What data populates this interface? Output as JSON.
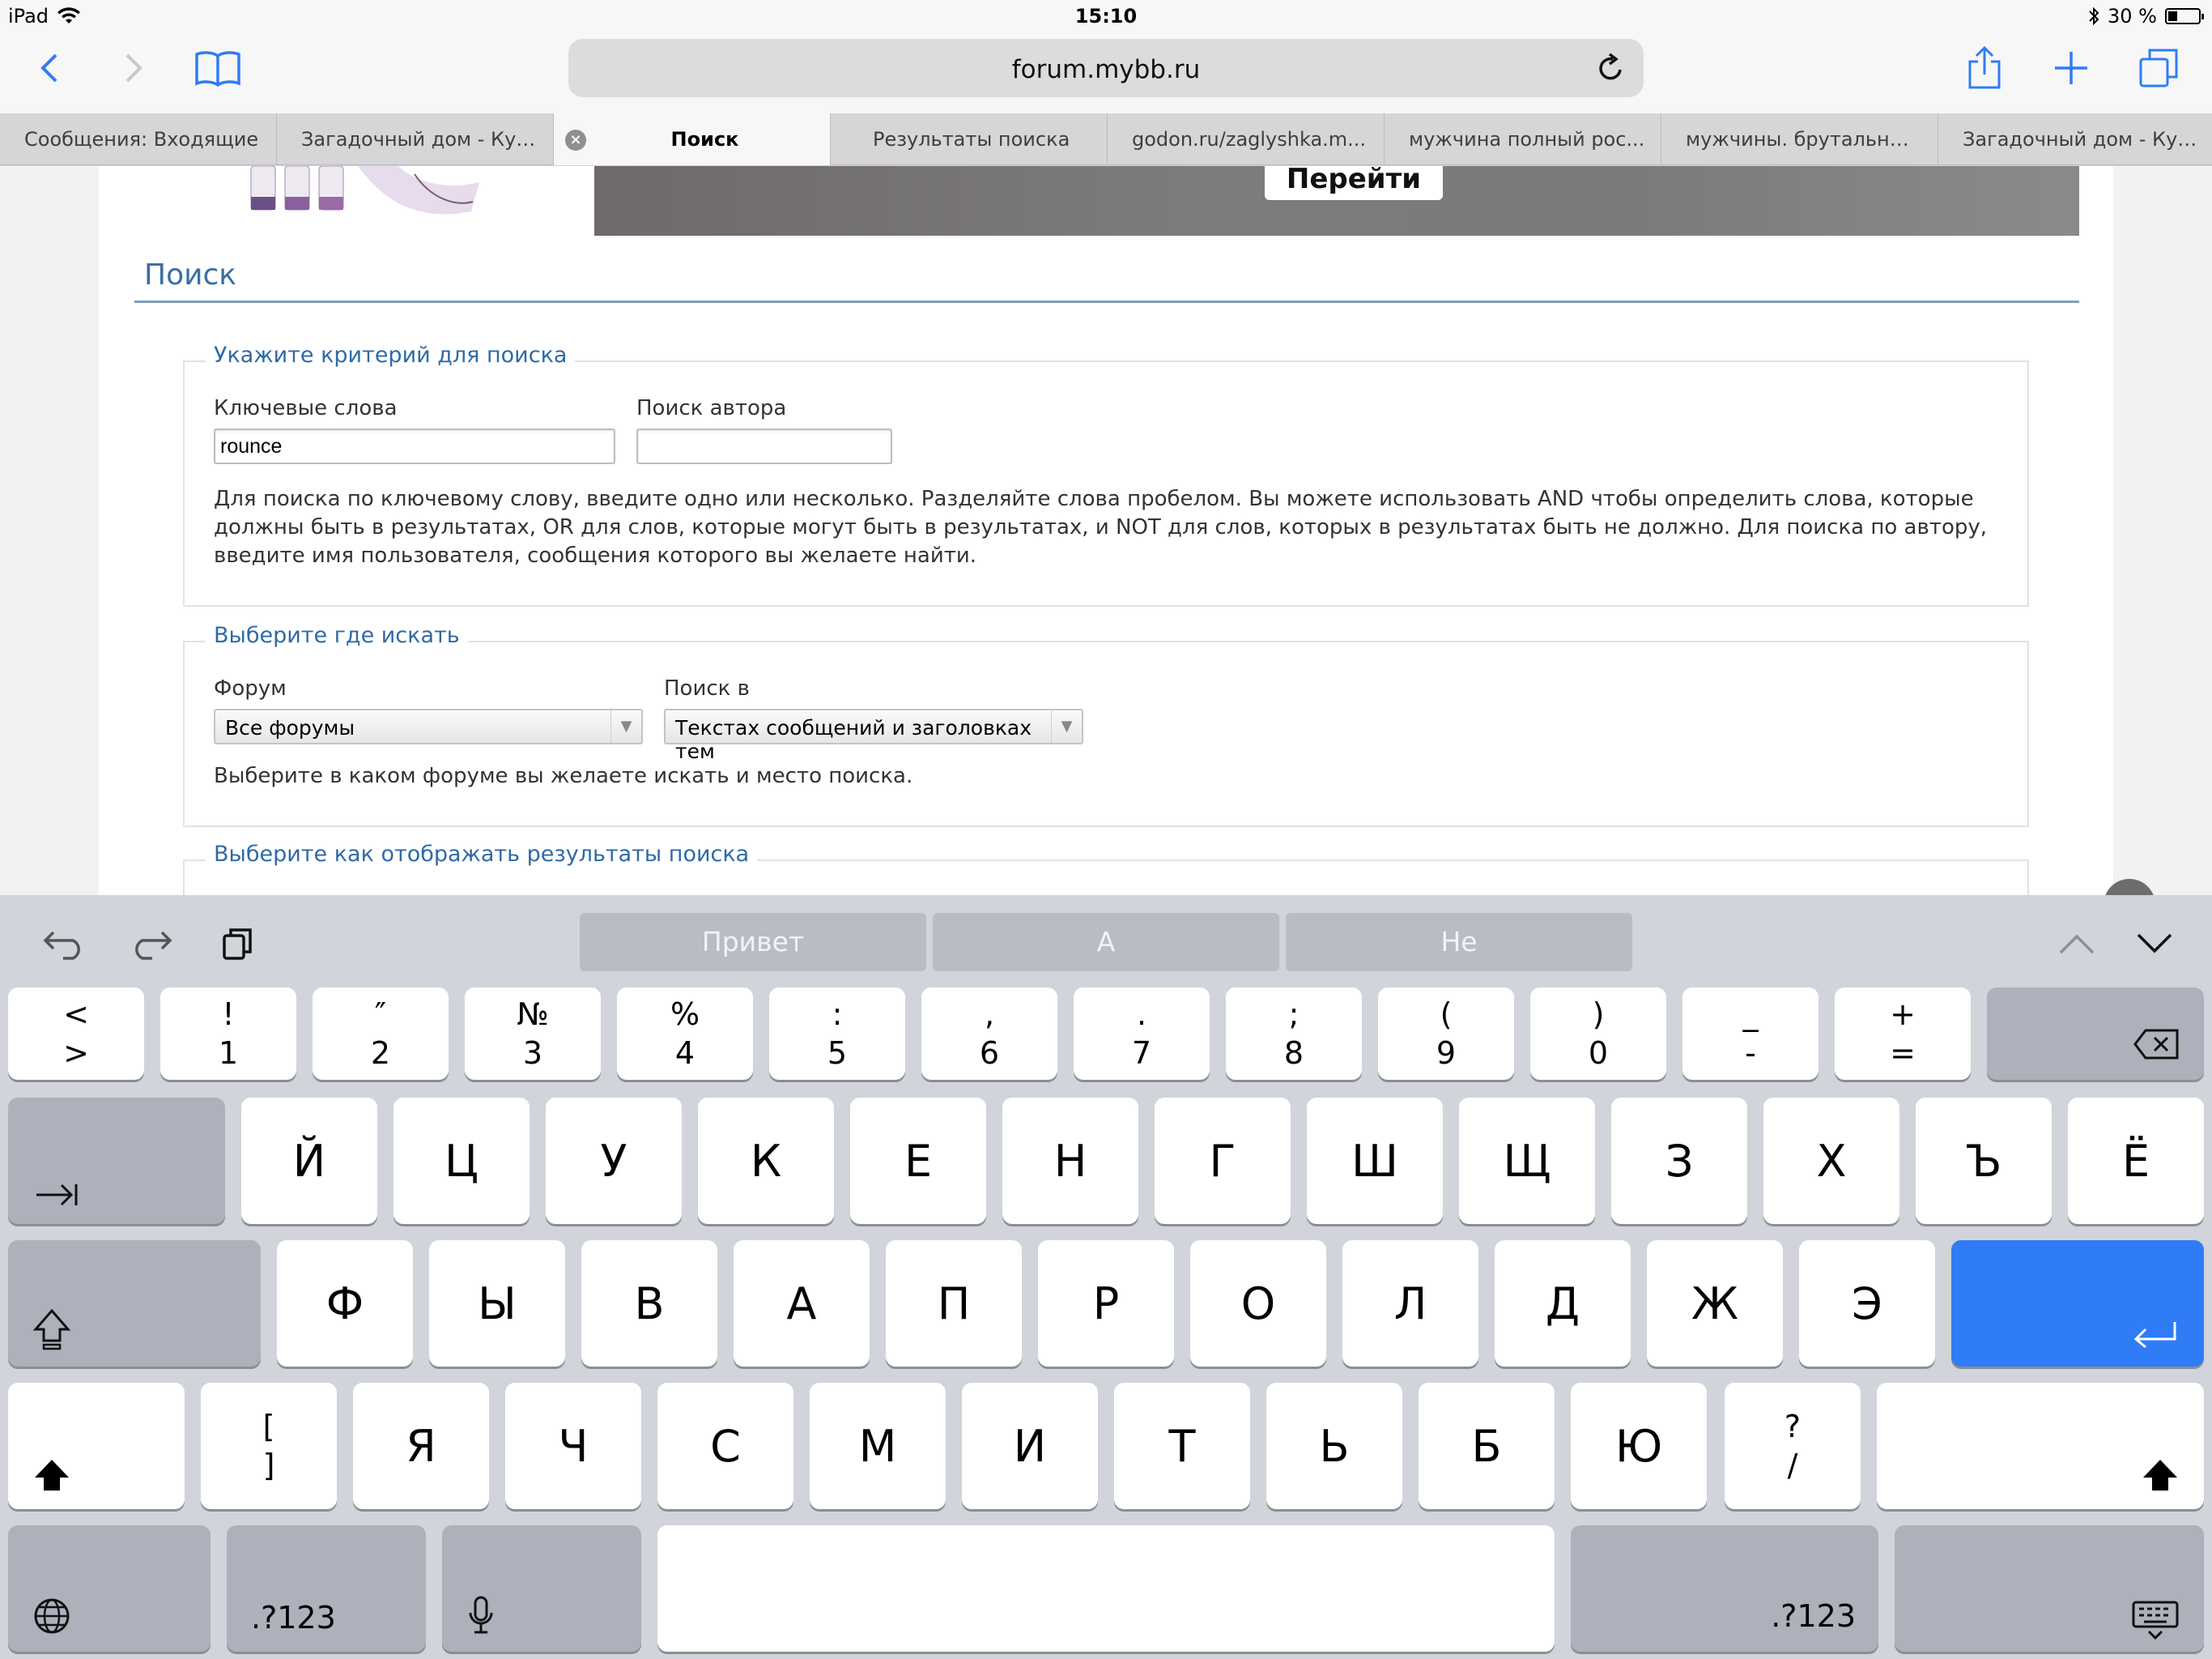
{
  "status": {
    "device": "iPad",
    "time": "15:10",
    "battery": "30 %",
    "battery_level": 0.3
  },
  "toolbar": {
    "url": "forum.mybb.ru"
  },
  "tabs": [
    {
      "label": "Сообщения: Входящие",
      "active": false
    },
    {
      "label": "Загадочный дом - Куз...",
      "active": false
    },
    {
      "label": "Поиск",
      "active": true
    },
    {
      "label": "Результаты поиска",
      "active": false
    },
    {
      "label": "godon.ru/zaglyshka.m...",
      "active": false
    },
    {
      "label": "мужчина полный рос...",
      "active": false
    },
    {
      "label": "мужчины. брутальны...",
      "active": false
    },
    {
      "label": "Загадочный дом - Куз...",
      "active": false
    }
  ],
  "page": {
    "banner_button": "Перейти",
    "section_title": "Поиск",
    "criteria": {
      "legend": "Укажите критерий для поиска",
      "keywords_label": "Ключевые слова",
      "keywords_value": "rounce",
      "author_label": "Поиск автора",
      "author_value": "",
      "help": "Для поиска по ключевому слову, введите одно или несколько. Разделяйте слова пробелом. Вы можете использовать AND чтобы определить слова, которые должны быть в результатах, OR для слов, которые могут быть в результатах, и NOT для слов, которых в результатах быть не должно. Для поиска по автору, введите имя пользователя, сообщения которого вы желаете найти."
    },
    "where": {
      "legend": "Выберите где искать",
      "forum_label": "Форум",
      "forum_value": "Все форумы",
      "searchin_label": "Поиск в",
      "searchin_value": "Текстах сообщений и заголовках тем",
      "help": "Выберите в каком форуме вы желаете искать и место поиска."
    },
    "display": {
      "legend": "Выберите как отображать результаты поиска"
    }
  },
  "keyboard": {
    "suggestions": [
      "Привет",
      "А",
      "Не"
    ],
    "row1": [
      {
        "top": "<",
        "bottom": ">"
      },
      {
        "top": "!",
        "bottom": "1"
      },
      {
        "top": "″",
        "bottom": "2"
      },
      {
        "top": "№",
        "bottom": "3"
      },
      {
        "top": "%",
        "bottom": "4"
      },
      {
        "top": ":",
        "bottom": "5"
      },
      {
        "top": ",",
        "bottom": "6"
      },
      {
        "top": ".",
        "bottom": "7"
      },
      {
        "top": ";",
        "bottom": "8"
      },
      {
        "top": "(",
        "bottom": "9"
      },
      {
        "top": ")",
        "bottom": "0"
      },
      {
        "top": "_",
        "bottom": "-"
      },
      {
        "top": "+",
        "bottom": "="
      }
    ],
    "row2": [
      "Й",
      "Ц",
      "У",
      "К",
      "Е",
      "Н",
      "Г",
      "Ш",
      "Щ",
      "З",
      "Х",
      "Ъ",
      "Ё"
    ],
    "row3": [
      "Ф",
      "Ы",
      "В",
      "А",
      "П",
      "Р",
      "О",
      "Л",
      "Д",
      "Ж",
      "Э"
    ],
    "row4": [
      "Я",
      "Ч",
      "С",
      "М",
      "И",
      "Т",
      "Ь",
      "Б",
      "Ю"
    ],
    "row4_bracket": {
      "top": "[",
      "bottom": "]"
    },
    "row4_slash": {
      "top": "?",
      "bottom": "/"
    },
    "numbers_label": ".?123",
    "colors": {
      "accent": "#2f7cf6",
      "key": "#ffffff",
      "dark_key": "#acb1bb"
    }
  }
}
